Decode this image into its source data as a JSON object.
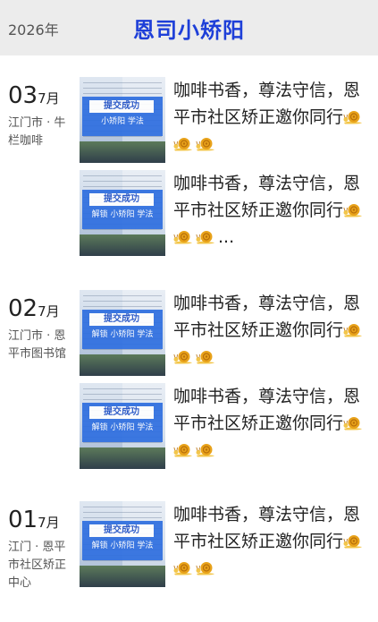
{
  "header": {
    "year": "2026年",
    "account_name": "恩司小矫阳"
  },
  "posts": [
    {
      "day": "03",
      "month": "7月",
      "location": "江门市 · 牛栏咖啡",
      "entries": [
        {
          "title": "咖啡书香，尊法守信，恩平市社区矫正邀你同行",
          "suffix": "",
          "thumb": {
            "badge": "提交成功",
            "caption": "小矫阳 学法"
          }
        },
        {
          "title": "咖啡书香，尊法守信，恩平市社区矫正邀你同行",
          "suffix": "...",
          "thumb": {
            "badge": "提交成功",
            "caption": "解锁 小矫阳 学法"
          }
        }
      ]
    },
    {
      "day": "02",
      "month": "7月",
      "location": "江门市 · 恩平市图书馆",
      "entries": [
        {
          "title": "咖啡书香，尊法守信，恩平市社区矫正邀你同行",
          "suffix": "",
          "thumb": {
            "badge": "提交成功",
            "caption": "解锁 小矫阳 学法"
          }
        },
        {
          "title": "咖啡书香，尊法守信，恩平市社区矫正邀你同行",
          "suffix": "",
          "thumb": {
            "badge": "提交成功",
            "caption": "解锁 小矫阳 学法"
          }
        }
      ]
    },
    {
      "day": "01",
      "month": "7月",
      "location": "江门 · 恩平市社区矫正中心",
      "entries": [
        {
          "title": "咖啡书香，尊法守信，恩平市社区矫正邀你同行",
          "suffix": "",
          "thumb": {
            "badge": "提交成功",
            "caption": "解锁 小矫阳 学法"
          }
        }
      ]
    }
  ],
  "emoji": {
    "name": "three-snails-emoji",
    "count": 3,
    "shell": "#e8a21a",
    "body": "#f3c64a"
  }
}
